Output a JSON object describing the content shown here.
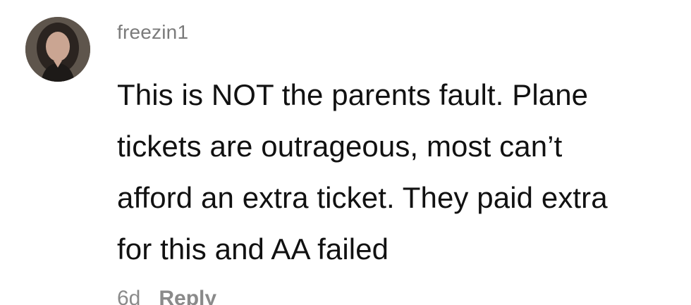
{
  "comment": {
    "username": "freezin1",
    "text": "This is NOT the parents fault. Plane\ntickets are outrageous, most can’t\nafford an extra ticket. They paid extra\nfor this and AA failed",
    "time": "6d",
    "reply_label": "Reply"
  },
  "colors": {
    "username": "#7b7b7b",
    "text": "#111111",
    "meta": "#8a8a8a"
  }
}
